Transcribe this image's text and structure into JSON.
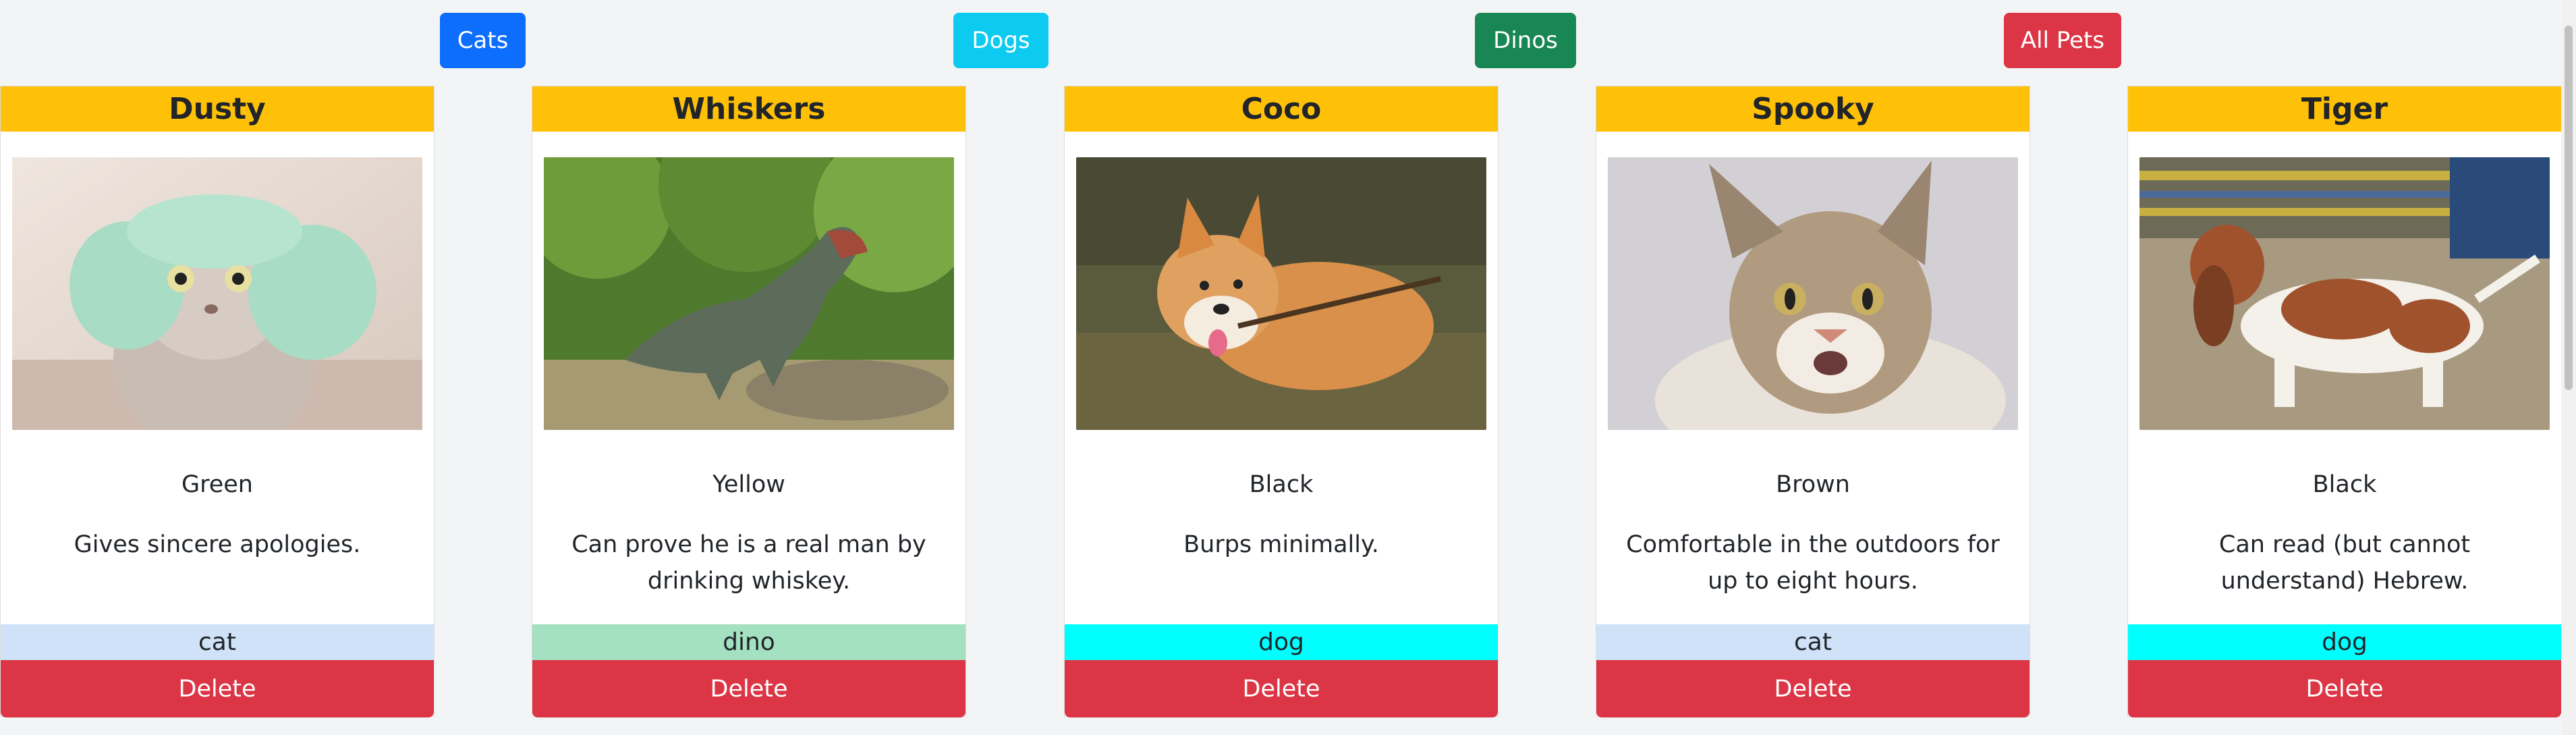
{
  "filters": {
    "cats_label": "Cats",
    "dogs_label": "Dogs",
    "dinos_label": "Dinos",
    "all_label": "All Pets"
  },
  "colors": {
    "name_header": "#ffc107",
    "cats_button": "#0d6efd",
    "dogs_button": "#0dcaf0",
    "dinos_button": "#198754",
    "all_button": "#dc3545",
    "delete_button": "#dc3545",
    "type_cat": "#cfe2f7",
    "type_dino": "#a3e1c0",
    "type_dog": "#00ffff"
  },
  "delete_label": "Delete",
  "pets": [
    {
      "name": "Dusty",
      "color": "Green",
      "description": "Gives sincere apologies.",
      "type": "cat",
      "image": "cat-in-green-hat-photo"
    },
    {
      "name": "Whiskers",
      "color": "Yellow",
      "description": "Can prove he is a real man by drinking whiskey.",
      "type": "dino",
      "image": "t-rex-statue-photo"
    },
    {
      "name": "Coco",
      "color": "Black",
      "description": "Burps minimally.",
      "type": "dog",
      "image": "corgi-with-stick-photo"
    },
    {
      "name": "Spooky",
      "color": "Brown",
      "description": "Comfortable in the outdoors for up to eight hours.",
      "type": "cat",
      "image": "maine-coon-cat-photo"
    },
    {
      "name": "Tiger",
      "color": "Black",
      "description": "Can read (but cannot understand) Hebrew.",
      "type": "dog",
      "image": "basset-hound-photo"
    }
  ]
}
